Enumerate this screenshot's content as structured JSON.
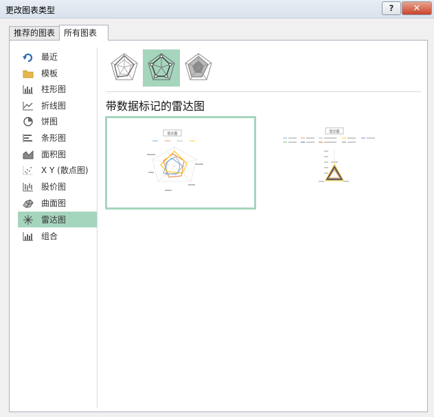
{
  "window": {
    "title": "更改图表类型",
    "help": "?",
    "close": "✕"
  },
  "tabs": [
    {
      "label": "推荐的图表"
    },
    {
      "label": "所有图表"
    }
  ],
  "categories": [
    {
      "label": "最近",
      "icon": "undo-icon"
    },
    {
      "label": "模板",
      "icon": "folder-icon"
    },
    {
      "label": "柱形图",
      "icon": "column-chart-icon"
    },
    {
      "label": "折线图",
      "icon": "line-chart-icon"
    },
    {
      "label": "饼图",
      "icon": "pie-chart-icon"
    },
    {
      "label": "条形图",
      "icon": "bar-chart-icon"
    },
    {
      "label": "面积图",
      "icon": "area-chart-icon"
    },
    {
      "label": "X Y (散点图)",
      "icon": "scatter-chart-icon"
    },
    {
      "label": "股价图",
      "icon": "stock-chart-icon"
    },
    {
      "label": "曲面图",
      "icon": "surface-chart-icon"
    },
    {
      "label": "雷达图",
      "icon": "radar-chart-icon"
    },
    {
      "label": "组合",
      "icon": "combo-chart-icon"
    }
  ],
  "selected_category": "雷达图",
  "subtypes": [
    {
      "name": "radar",
      "selected": false
    },
    {
      "name": "radar-with-markers",
      "selected": true
    },
    {
      "name": "filled-radar",
      "selected": false
    }
  ],
  "heading": "带数据标记的雷达图",
  "previews": [
    {
      "chart_title": "雷达图"
    },
    {
      "chart_title": "雷达图"
    }
  ],
  "colors": {
    "accent": "#a6d5bd",
    "series": [
      "#5b9bd5",
      "#ed7d31",
      "#a5a5a5",
      "#ffc000",
      "#4472c4",
      "#70ad47",
      "#264478"
    ]
  }
}
